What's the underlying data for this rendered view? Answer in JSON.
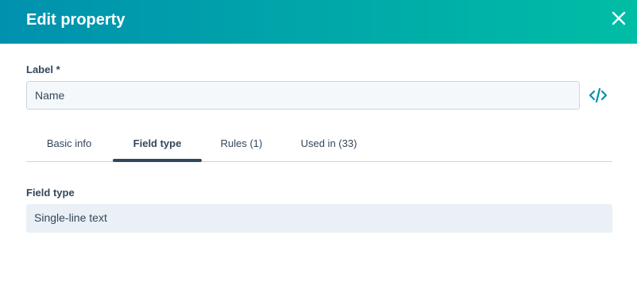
{
  "header": {
    "title": "Edit property",
    "close_icon": "close-icon"
  },
  "label_field": {
    "label": "Label *",
    "value": "Name",
    "code_icon": "code-icon"
  },
  "tabs": [
    {
      "label": "Basic info",
      "active": false
    },
    {
      "label": "Field type",
      "active": true
    },
    {
      "label": "Rules (1)",
      "active": false
    },
    {
      "label": "Used in (33)",
      "active": false
    }
  ],
  "field_type": {
    "label": "Field type",
    "value": "Single-line text"
  },
  "colors": {
    "header_gradient_start": "#0091ae",
    "header_gradient_end": "#00bda5",
    "text": "#33475b",
    "accent": "#0091ae"
  }
}
